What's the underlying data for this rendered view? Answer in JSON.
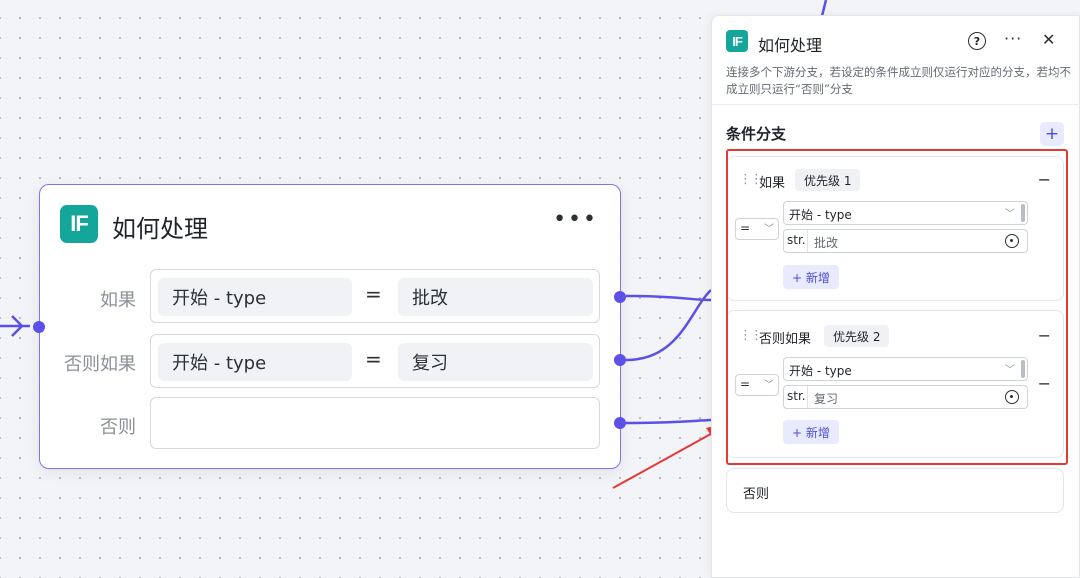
{
  "node": {
    "badge": "IF",
    "title": "如何处理",
    "more": "•••",
    "rows": [
      {
        "label": "如果",
        "left": "开始  -  type",
        "operator": "=",
        "right": "批改"
      },
      {
        "label": "否则如果",
        "left": "开始  -  type",
        "operator": "=",
        "right": "复习"
      },
      {
        "label": "否则",
        "left": "",
        "operator": "",
        "right": ""
      }
    ]
  },
  "panel": {
    "badge": "IF",
    "title": "如何处理",
    "help_icon": "?",
    "more_icon": "···",
    "close_icon": "✕",
    "description": "连接多个下游分支，若设定的条件成立则仅运行对应的分支，若均不成立则只运行“否则”分支",
    "section_title": "条件分支",
    "add_icon": "+",
    "branches": [
      {
        "label": "如果",
        "priority": "优先级 1",
        "operator": "=",
        "field": "开始 - type",
        "value_type": "str.",
        "value": "批改",
        "new_button": "+ 新增",
        "remove_icon": "−"
      },
      {
        "label": "否则如果",
        "priority": "优先级 2",
        "operator": "=",
        "field": "开始 - type",
        "value_type": "str.",
        "value": "复习",
        "new_button": "+ 新增",
        "remove_icon": "−",
        "remove_condition_icon": "−"
      }
    ],
    "else_label": "否则"
  },
  "colors": {
    "accent": "#5b50e8",
    "if_badge": "#15a69b",
    "highlight": "#e53935"
  }
}
